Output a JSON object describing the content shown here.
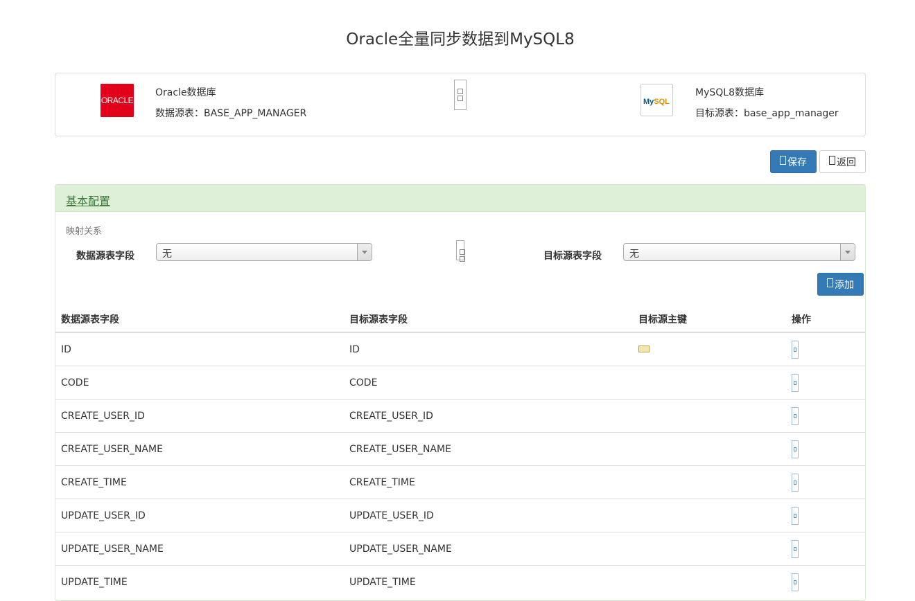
{
  "page_title": "Oracle全量同步数据到MySQL8",
  "source": {
    "logo_text": "ORACLE",
    "db_name": "Oracle数据库",
    "table_label": "数据源表：BASE_APP_MANAGER"
  },
  "target": {
    "logo_text_a": "My",
    "logo_text_b": "SQL",
    "db_name": "MySQL8数据库",
    "table_label": "目标源表：base_app_manager"
  },
  "toolbar": {
    "save_label": "保存",
    "back_label": "返回"
  },
  "config": {
    "title": "基本配置",
    "mapping_label": "映射关系",
    "source_field_label": "数据源表字段",
    "source_field_value": "无",
    "target_field_label": "目标源表字段",
    "target_field_value": "无",
    "add_label": "添加"
  },
  "table": {
    "headers": [
      "数据源表字段",
      "目标源表字段",
      "目标源主键",
      "操作"
    ],
    "rows": [
      {
        "source": "ID",
        "target": "ID",
        "primary_key": true
      },
      {
        "source": "CODE",
        "target": "CODE",
        "primary_key": false
      },
      {
        "source": "CREATE_USER_ID",
        "target": "CREATE_USER_ID",
        "primary_key": false
      },
      {
        "source": "CREATE_USER_NAME",
        "target": "CREATE_USER_NAME",
        "primary_key": false
      },
      {
        "source": "CREATE_TIME",
        "target": "CREATE_TIME",
        "primary_key": false
      },
      {
        "source": "UPDATE_USER_ID",
        "target": "UPDATE_USER_ID",
        "primary_key": false
      },
      {
        "source": "UPDATE_USER_NAME",
        "target": "UPDATE_USER_NAME",
        "primary_key": false
      },
      {
        "source": "UPDATE_TIME",
        "target": "UPDATE_TIME",
        "primary_key": false
      }
    ]
  },
  "colors": {
    "primary": "#337ab7",
    "panel_success_bg": "#dff0d8",
    "panel_success_text": "#3c763d",
    "oracle_red": "#e2001a"
  }
}
